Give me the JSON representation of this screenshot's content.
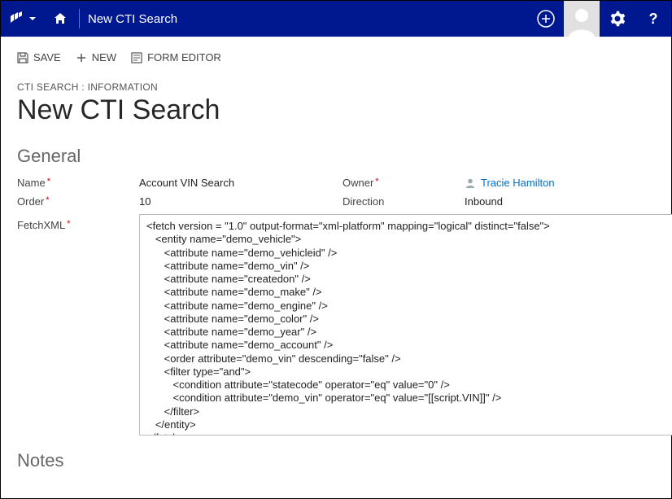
{
  "topbar": {
    "title": "New CTI Search"
  },
  "commands": {
    "save": "SAVE",
    "new": "NEW",
    "form_editor": "FORM EDITOR"
  },
  "breadcrumb": "CTI SEARCH : INFORMATION",
  "page_title": "New CTI Search",
  "section_general": "General",
  "section_notes": "Notes",
  "labels": {
    "name": "Name",
    "order": "Order",
    "owner": "Owner",
    "direction": "Direction",
    "fetchxml": "FetchXML"
  },
  "values": {
    "name": "Account VIN Search",
    "order": "10",
    "owner": "Tracie Hamilton",
    "direction": "Inbound",
    "fetchxml": "<fetch version = \"1.0\" output-format=\"xml-platform\" mapping=\"logical\" distinct=\"false\">\n   <entity name=\"demo_vehicle\">\n      <attribute name=\"demo_vehicleid\" />\n      <attribute name=\"demo_vin\" />\n      <attribute name=\"createdon\" />\n      <attribute name=\"demo_make\" />\n      <attribute name=\"demo_engine\" />\n      <attribute name=\"demo_color\" />\n      <attribute name=\"demo_year\" />\n      <attribute name=\"demo_account\" />\n      <order attribute=\"demo_vin\" descending=\"false\" />\n      <filter type=\"and\">\n         <condition attribute=\"statecode\" operator=\"eq\" value=\"0\" />\n         <condition attribute=\"demo_vin\" operator=\"eq\" value=\"[[script.VIN]]\" />\n      </filter>\n   </entity>\n</fetch>"
  }
}
